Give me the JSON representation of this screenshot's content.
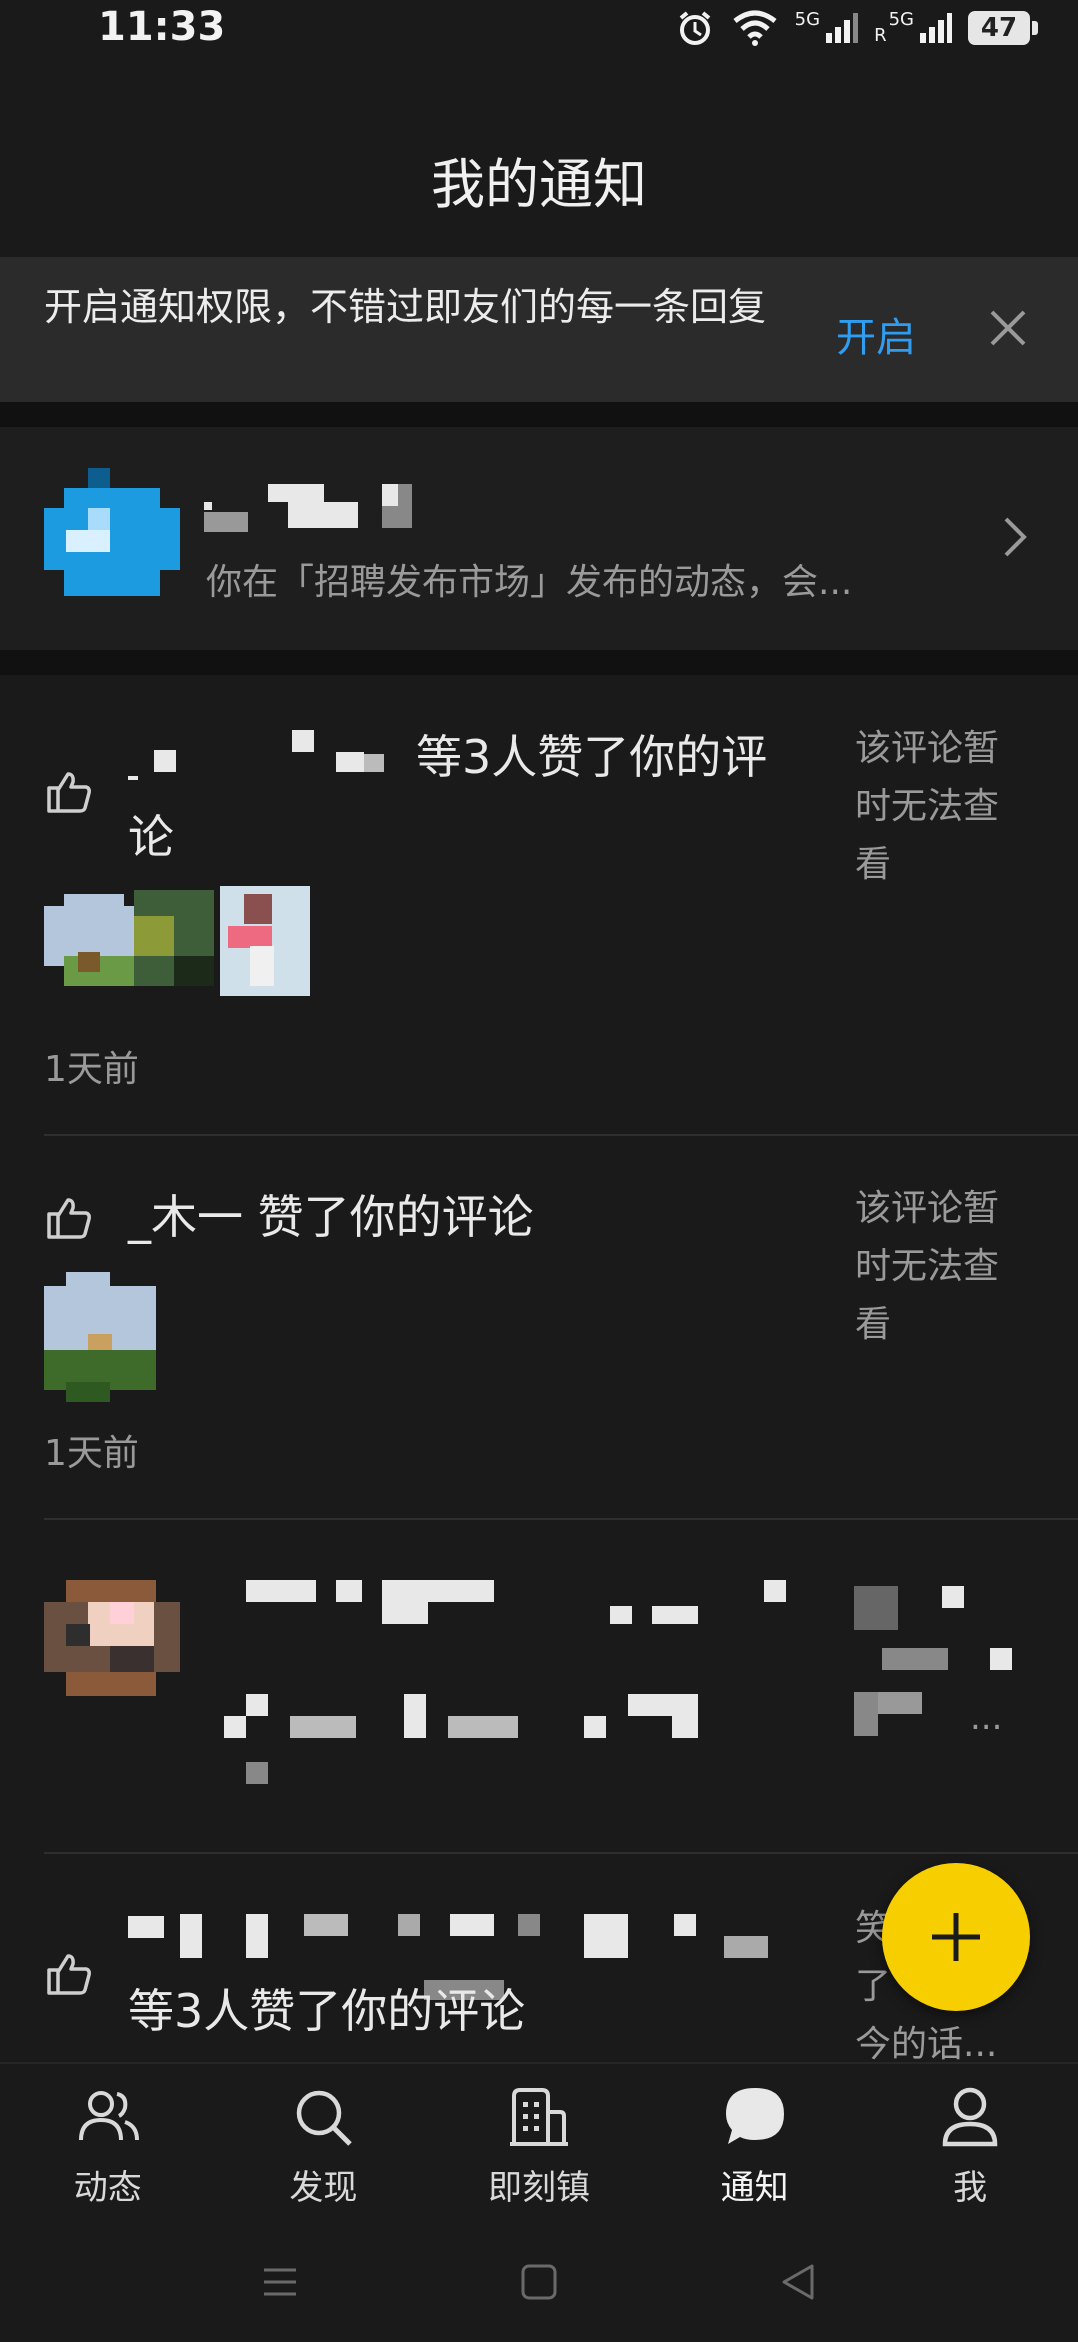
{
  "status_bar": {
    "time": "11:33",
    "battery": "47",
    "net1": "5G",
    "net2": "5G",
    "roaming": "R"
  },
  "header": {
    "title": "我的通知"
  },
  "banner": {
    "text": "开启通知权限，不错过即友们的每一条回复",
    "action": "开启"
  },
  "summary": {
    "text": "你在「招聘发布市场」发布的动态，会..."
  },
  "items": [
    {
      "text": "等3人赞了你的评",
      "text2": "论",
      "side": [
        "该评论暂",
        "时无法查",
        "看"
      ],
      "time": "1天前"
    },
    {
      "text": "_木一 赞了你的评论",
      "side": [
        "该评论暂",
        "时无法查",
        "看"
      ],
      "time": "1天前"
    },
    {
      "side_ellipsis": "..."
    },
    {
      "text": "等3人赞了你的评论",
      "side": [
        "笑",
        "了",
        "今的话..."
      ]
    }
  ],
  "nav": [
    {
      "label": "动态",
      "icon": "users-icon"
    },
    {
      "label": "发现",
      "icon": "search-icon"
    },
    {
      "label": "即刻镇",
      "icon": "building-icon"
    },
    {
      "label": "通知",
      "icon": "chat-bubble-icon"
    },
    {
      "label": "我",
      "icon": "person-icon"
    }
  ],
  "colors": {
    "background": "#1a1a1a",
    "accent_blue": "#2f9df0",
    "fab_yellow": "#f7cf00"
  }
}
